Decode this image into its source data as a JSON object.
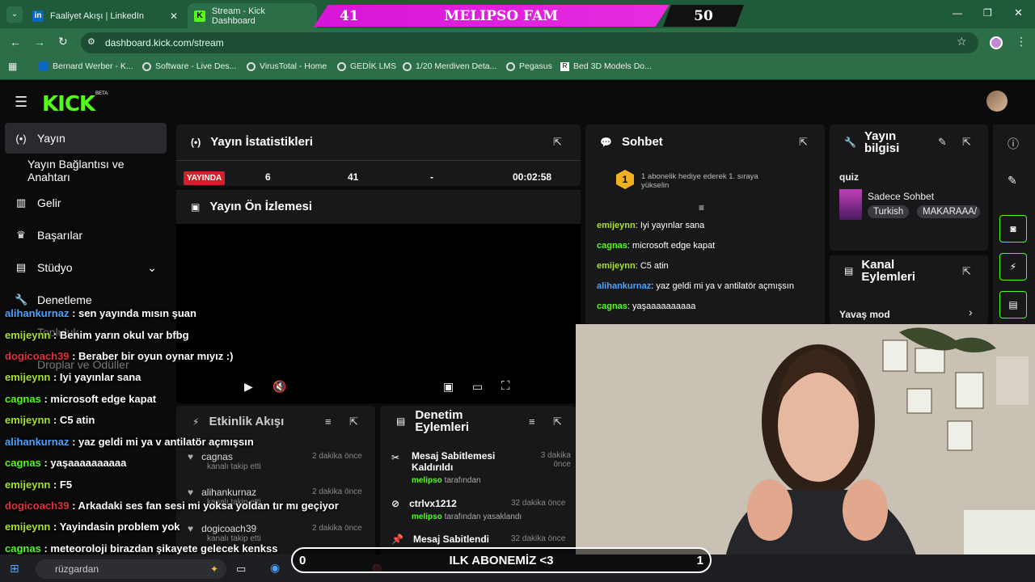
{
  "browser": {
    "tabs": [
      {
        "label": "Faaliyet Akışı | LinkedIn"
      },
      {
        "label": "Stream - Kick Dashboard"
      }
    ],
    "url": "dashboard.kick.com/stream",
    "bookmarks": [
      "Bernard Werber - K...",
      "Software - Live Des...",
      "VirusTotal - Home",
      "GEDİK LMS",
      "1/20 Merdiven Deta...",
      "Pegasus",
      "Bed 3D Models Do..."
    ]
  },
  "banner": {
    "left": "41",
    "title": "MELIPSO FAM",
    "right": "50"
  },
  "kick": {
    "logo": "KICK",
    "beta": "BETA"
  },
  "sidebar": {
    "items": [
      {
        "label": "Yayın",
        "icon": "broadcast-icon"
      },
      {
        "label": "Yayın Bağlantısı ve Anahtarı"
      },
      {
        "label": "Gelir",
        "icon": "chart-icon"
      },
      {
        "label": "Başarılar",
        "icon": "trophy-icon"
      },
      {
        "label": "Stüdyo",
        "icon": "studio-icon"
      },
      {
        "label": "Denetleme",
        "icon": "wrench-icon"
      },
      {
        "label": "Topluluk"
      },
      {
        "label": "Droplar ve Ödüller"
      }
    ]
  },
  "stats": {
    "title": "Yayın İstatistikleri",
    "badge": "YAYINDA",
    "values": [
      "6",
      "41",
      "-",
      "00:02:58"
    ]
  },
  "preview": {
    "title": "Yayın Ön İzlemesi"
  },
  "chat": {
    "title": "Sohbet",
    "pinned": "1 abonelik hediye ederek 1. sıraya yükselin",
    "pinned_rank": "1",
    "messages": [
      {
        "user": "emijeynn",
        "text": "Iyi yayınlar sana",
        "color": "#a6e22e"
      },
      {
        "user": "cagnas",
        "text": "microsoft edge kapat",
        "color": "#53fc18"
      },
      {
        "user": "emijeynn",
        "text": "C5 atin",
        "color": "#a6e22e"
      },
      {
        "user": "alihankurnaz",
        "text": "yaz geldi mi ya v antilatör açmışsın",
        "color": "#4aa3ff"
      },
      {
        "user": "cagnas",
        "text": "yaşaaaaaaaaaa",
        "color": "#53fc18"
      }
    ]
  },
  "info": {
    "title": "Yayın bilgisi",
    "stream_title": "quiz",
    "category": "Sadece Sohbet",
    "tags": [
      "Turkish",
      "MAKARAAA/"
    ]
  },
  "channel_actions": {
    "title": "Kanal Eylemleri",
    "slow_mode": "Yavaş mod"
  },
  "activity": {
    "title": "Etkinlik Akışı",
    "events": [
      {
        "user": "cagnas",
        "desc": "kanalı takip etti",
        "time": "2 dakika önce"
      },
      {
        "user": "alihankurnaz",
        "desc": "kanalı takip etti",
        "time": "2 dakika önce"
      },
      {
        "user": "dogicoach39",
        "desc": "kanalı takip etti",
        "time": "2 dakika önce"
      }
    ]
  },
  "moderation": {
    "title": "Denetim Eylemleri",
    "events": [
      {
        "title": "Mesaj Sabitlemesi Kaldırıldı",
        "by": "melipso",
        "suffix": "tarafından",
        "time": "3 dakika önce"
      },
      {
        "title": "ctrlvx1212",
        "by": "melipso",
        "suffix": "tarafından yasaklandı",
        "time": "32 dakika önce"
      },
      {
        "title": "Mesaj Sabitlendi",
        "time": "32 dakika önce"
      }
    ]
  },
  "overlay_chat": [
    {
      "user": "alihankurnaz",
      "text": ": sen yayında mısın şuan",
      "color": "#4aa3ff"
    },
    {
      "user": "emijeynn",
      "text": ": Benim yarın okul var bfbg",
      "color": "#a6e22e"
    },
    {
      "user": "dogicoach39",
      "text": ": Beraber bir oyun oynar mıyız :)",
      "color": "#e0303a"
    },
    {
      "user": "emijeynn",
      "text": ": Iyi yayınlar sana",
      "color": "#a6e22e"
    },
    {
      "user": "cagnas",
      "text": ": microsoft edge kapat",
      "color": "#53fc18"
    },
    {
      "user": "emijeynn",
      "text": ": C5 atin",
      "color": "#a6e22e"
    },
    {
      "user": "alihankurnaz",
      "text": ": yaz geldi mi ya v antilatör açmışsın",
      "color": "#4aa3ff"
    },
    {
      "user": "cagnas",
      "text": ": yaşaaaaaaaaaa",
      "color": "#53fc18"
    },
    {
      "user": "emijeynn",
      "text": ": F5",
      "color": "#a6e22e"
    },
    {
      "user": "dogicoach39",
      "text": ": Arkadaki ses fan sesi mi yoksa yoldan tır mı geçiyor",
      "color": "#e0303a"
    },
    {
      "user": "emijeynn",
      "text": ": Yayindasin problem yok",
      "color": "#a6e22e"
    },
    {
      "user": "cagnas",
      "text": ": meteoroloji birazdan şikayete gelecek kenkss",
      "color": "#53fc18"
    }
  ],
  "taskbar": {
    "search": "rüzgardan"
  },
  "subgoal": {
    "start": "0",
    "label": "ILK ABONEMİZ <3",
    "end": "1"
  }
}
